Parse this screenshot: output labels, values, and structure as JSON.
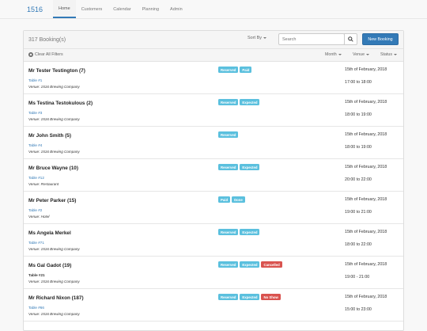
{
  "nav": {
    "brand": "1516",
    "items": [
      "Home",
      "Customers",
      "Calendar",
      "Planning",
      "Admin"
    ],
    "active": 0
  },
  "toolbar": {
    "count": "317 Booking(s)",
    "sort_label": "Sort By",
    "search_placeholder": "Search",
    "new_label": "New Booking"
  },
  "filters": {
    "clear_label": "Clear All Filters",
    "month": "Month",
    "venue": "Venue",
    "status": "Status"
  },
  "colors": {
    "info": "#5bc0de",
    "danger": "#d9534f",
    "primary": "#337ab7"
  },
  "bookings": [
    {
      "name": "Mr Tester Testington (7)",
      "table": "Table #1",
      "table_link": true,
      "venue": "Venue: 1516 Brewing Company",
      "badges": [
        {
          "t": "Reserved",
          "c": "info"
        },
        {
          "t": "Paid",
          "c": "info"
        }
      ],
      "date": "15th of February, 2018",
      "time": "17:00 to 18:00"
    },
    {
      "name": "Ms Testina Testokulous (2)",
      "table": "Table #3",
      "table_link": true,
      "venue": "Venue: 1516 Brewing Company",
      "badges": [
        {
          "t": "Reserved",
          "c": "info"
        },
        {
          "t": "Expected",
          "c": "info"
        }
      ],
      "date": "15th of February, 2018",
      "time": "18:00 to 19:00"
    },
    {
      "name": "Mr John Smith (5)",
      "table": "Table #4",
      "table_link": true,
      "venue": "Venue: 1516 Brewing Company",
      "badges": [
        {
          "t": "Reserved",
          "c": "info"
        }
      ],
      "date": "15th of February, 2018",
      "time": "18:00 to 19:00"
    },
    {
      "name": "Mr Bruce Wayne (10)",
      "table": "Table #12",
      "table_link": true,
      "venue": "Venue: Restaurant",
      "badges": [
        {
          "t": "Reserved",
          "c": "info"
        },
        {
          "t": "Expected",
          "c": "info"
        }
      ],
      "date": "15th of February, 2018",
      "time": "20:00 to 22:00"
    },
    {
      "name": "Mr Peter Parker (15)",
      "table": "Table #2",
      "table_link": true,
      "venue": "Venue: Hotel",
      "badges": [
        {
          "t": "Paid",
          "c": "info"
        },
        {
          "t": "Done",
          "c": "info"
        }
      ],
      "date": "15th of February, 2018",
      "time": "19:00 to 21:00"
    },
    {
      "name": "Ms Angela Merkel",
      "table": "Table #71",
      "table_link": true,
      "venue": "Venue: 1516 Brewing Company",
      "badges": [
        {
          "t": "Reserved",
          "c": "info"
        },
        {
          "t": "Expected",
          "c": "info"
        }
      ],
      "date": "15th of February, 2018",
      "time": "18:00 to 22:00"
    },
    {
      "name": "Ms Gal Gadot (19)",
      "table": "Table #21",
      "table_link": false,
      "venue": "Venue: 1516 Brewing Company",
      "badges": [
        {
          "t": "Reserved",
          "c": "info"
        },
        {
          "t": "Expected",
          "c": "info"
        },
        {
          "t": "Cancelled",
          "c": "danger"
        }
      ],
      "date": "15th of February, 2018",
      "time": "19:00 - 21:00"
    },
    {
      "name": "Mr Richard Nixon (187)",
      "table": "Table #66",
      "table_link": true,
      "venue": "Venue: 1516 Brewing Company",
      "badges": [
        {
          "t": "Reserved",
          "c": "info"
        },
        {
          "t": "Expected",
          "c": "info"
        },
        {
          "t": "No Show",
          "c": "danger"
        }
      ],
      "date": "15th of February, 2018",
      "time": "15:00 to 23:00"
    }
  ]
}
